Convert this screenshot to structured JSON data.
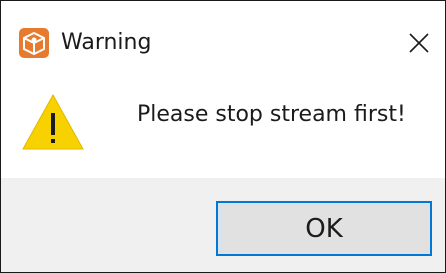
{
  "window": {
    "title": "Warning",
    "close_icon": "close-icon",
    "app_icon": "app-logo-icon"
  },
  "message": {
    "icon": "warning-triangle-icon",
    "text": "Please stop stream first!"
  },
  "buttons": {
    "ok_label": "OK"
  },
  "colors": {
    "accent": "#0078d7",
    "warning": "#f8d200",
    "app_icon": "#e67a2e",
    "footer_bg": "#f0f0f0"
  }
}
